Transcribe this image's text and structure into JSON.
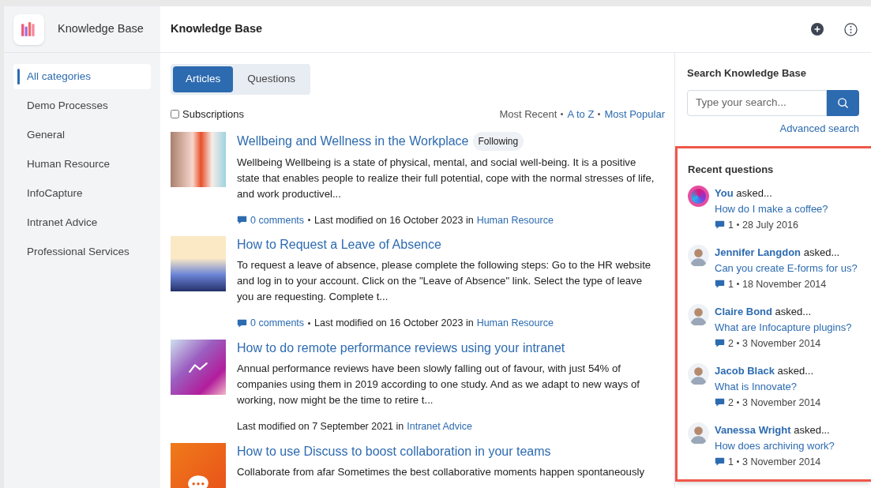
{
  "app": {
    "name": "Knowledge Base"
  },
  "header": {
    "title": "Knowledge Base"
  },
  "sidebar": {
    "items": [
      {
        "label": "All categories",
        "selected": true
      },
      {
        "label": "Demo Processes",
        "selected": false
      },
      {
        "label": "General",
        "selected": false
      },
      {
        "label": "Human Resource",
        "selected": false
      },
      {
        "label": "InfoCapture",
        "selected": false
      },
      {
        "label": "Intranet Advice",
        "selected": false
      },
      {
        "label": "Professional Services",
        "selected": false
      }
    ]
  },
  "tabs": [
    {
      "label": "Articles",
      "selected": true
    },
    {
      "label": "Questions",
      "selected": false
    }
  ],
  "subscriptions": {
    "label": "Subscriptions",
    "checked": false
  },
  "sort": [
    {
      "label": "Most Recent",
      "selected": true
    },
    {
      "label": "A to Z",
      "selected": false
    },
    {
      "label": "Most Popular",
      "selected": false
    }
  ],
  "articles": [
    {
      "kind": "office",
      "title": "Wellbeing and Wellness in the Workplace",
      "badge": "Following",
      "excerpt": "Wellbeing Wellbeing is a state of physical, mental, and social well-being. It is a positive state that enables people to realize their full potential, cope with the normal stresses of life, and work productivel...",
      "comments": "0 comments",
      "modified": "Last modified on 16 October 2023 in",
      "category": "Human Resource"
    },
    {
      "kind": "person",
      "title": "How to Request a Leave of Absence",
      "excerpt": "To request a leave of absence, please complete the following steps: Go to the HR website and log in to your account. Click on the \"Leave of Absence\" link. Select the type of leave you are requesting. Complete t...",
      "comments": "0 comments",
      "modified": "Last modified on 16 October 2023 in",
      "category": "Human Resource"
    },
    {
      "kind": "chart",
      "title": "How to do remote performance reviews using your intranet",
      "excerpt": "Annual performance reviews have been slowly falling out of favour, with just 54% of companies using them in 2019 according to one study. And as we adapt to new ways of working, now might be the time to retire t...",
      "modified": "Last modified on 7 September 2021 in",
      "category": "Intranet Advice"
    },
    {
      "kind": "chat",
      "title": "How to use Discuss to boost collaboration in your teams",
      "excerpt": "Collaborate from afar Sometimes the best collaborative moments happen spontaneously"
    }
  ],
  "search": {
    "title": "Search Knowledge Base",
    "placeholder": "Type your search...",
    "advanced": "Advanced search"
  },
  "recent_questions": {
    "title": "Recent questions",
    "items": [
      {
        "kind": "logo",
        "author": "You",
        "verb": "asked...",
        "question": "How do I make a coffee?",
        "count": "1",
        "date": "28 July 2016"
      },
      {
        "kind": "photo",
        "author": "Jennifer Langdon",
        "verb": "asked...",
        "question": "Can you create E-forms for us?",
        "count": "1",
        "date": "18 November 2014"
      },
      {
        "kind": "photo",
        "author": "Claire Bond",
        "verb": "asked...",
        "question": "What are Infocapture plugins?",
        "count": "2",
        "date": "3 November 2014"
      },
      {
        "kind": "photo",
        "author": "Jacob Black",
        "verb": "asked...",
        "question": "What is Innovate?",
        "count": "2",
        "date": "3 November 2014"
      },
      {
        "kind": "photo",
        "author": "Vanessa Wright",
        "verb": "asked...",
        "question": "How does archiving work?",
        "count": "1",
        "date": "3 November 2014"
      }
    ]
  }
}
